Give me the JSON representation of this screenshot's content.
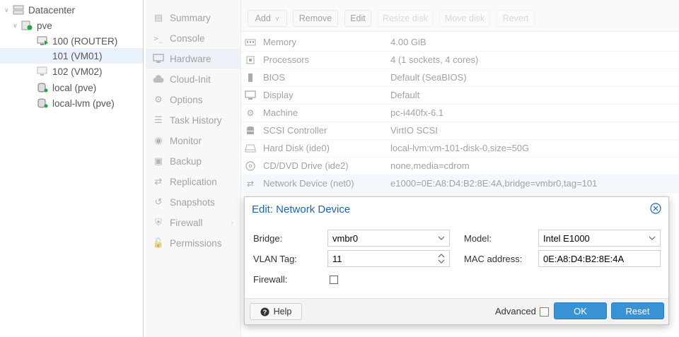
{
  "tree": {
    "datacenter": "Datacenter",
    "node": "pve",
    "items": [
      {
        "label": "100 (ROUTER)"
      },
      {
        "label": "101 (VM01)"
      },
      {
        "label": "102 (VM02)"
      },
      {
        "label": "local (pve)"
      },
      {
        "label": "local-lvm (pve)"
      }
    ]
  },
  "nav": {
    "items": [
      {
        "label": "Summary"
      },
      {
        "label": "Console"
      },
      {
        "label": "Hardware"
      },
      {
        "label": "Cloud-Init"
      },
      {
        "label": "Options"
      },
      {
        "label": "Task History"
      },
      {
        "label": "Monitor"
      },
      {
        "label": "Backup"
      },
      {
        "label": "Replication"
      },
      {
        "label": "Snapshots"
      },
      {
        "label": "Firewall"
      },
      {
        "label": "Permissions"
      }
    ]
  },
  "toolbar": {
    "add": "Add",
    "remove": "Remove",
    "edit": "Edit",
    "resize": "Resize disk",
    "move": "Move disk",
    "revert": "Revert"
  },
  "hardware": [
    {
      "name": "Memory",
      "value": "4.00 GiB"
    },
    {
      "name": "Processors",
      "value": "4 (1 sockets, 4 cores)"
    },
    {
      "name": "BIOS",
      "value": "Default (SeaBIOS)"
    },
    {
      "name": "Display",
      "value": "Default"
    },
    {
      "name": "Machine",
      "value": "pc-i440fx-6.1"
    },
    {
      "name": "SCSI Controller",
      "value": "VirtIO SCSI"
    },
    {
      "name": "Hard Disk (ide0)",
      "value": "local-lvm:vm-101-disk-0,size=50G"
    },
    {
      "name": "CD/DVD Drive (ide2)",
      "value": "none,media=cdrom"
    },
    {
      "name": "Network Device (net0)",
      "value": "e1000=0E:A8:D4:B2:8E:4A,bridge=vmbr0,tag=101"
    }
  ],
  "dialog": {
    "title": "Edit: Network Device",
    "bridge_label": "Bridge:",
    "bridge_value": "vmbr0",
    "vlan_label": "VLAN Tag:",
    "vlan_value": "11",
    "firewall_label": "Firewall:",
    "model_label": "Model:",
    "model_value": "Intel E1000",
    "mac_label": "MAC address:",
    "mac_value": "0E:A8:D4:B2:8E:4A",
    "help": "Help",
    "advanced": "Advanced",
    "ok": "OK",
    "reset": "Reset"
  },
  "colors": {
    "accent": "#3892d4",
    "title": "#1d65ab"
  }
}
